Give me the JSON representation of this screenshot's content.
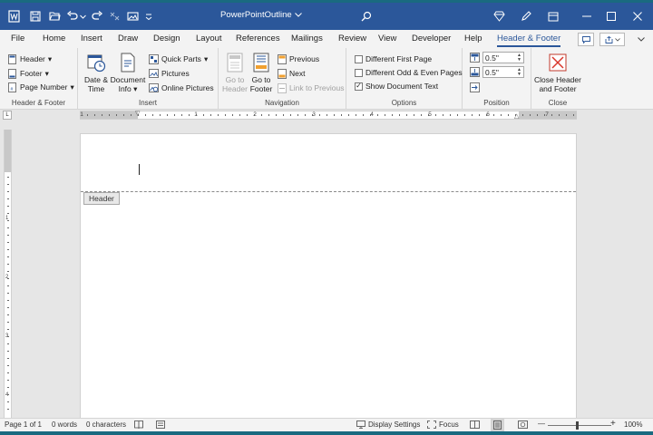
{
  "title_bar": {
    "doc_name": "PowerPointOutline",
    "quick_access": [
      "word-logo-icon",
      "save-icon",
      "open-icon",
      "undo-icon",
      "undo-dropdown-icon",
      "redo-icon",
      "format-painter-icon",
      "insert-picture-icon",
      "customize-icon"
    ]
  },
  "colors": {
    "brand": "#2b579a",
    "frame": "#1a6a80",
    "ribbon": "#f3f3f3",
    "canvas": "#e6e6e6"
  },
  "menu": {
    "tabs": [
      "File",
      "Home",
      "Insert",
      "Draw",
      "Design",
      "Layout",
      "References",
      "Mailings",
      "Review",
      "View",
      "Developer",
      "Help",
      "Header & Footer"
    ],
    "active_tab": "Header & Footer"
  },
  "ribbon": {
    "header_footer": {
      "label": "Header & Footer",
      "header": "Header",
      "footer": "Footer",
      "page_number": "Page Number"
    },
    "insert": {
      "label": "Insert",
      "date_time_1": "Date &",
      "date_time_2": "Time",
      "doc_info_1": "Document",
      "doc_info_2": "Info",
      "quick_parts": "Quick Parts",
      "pictures": "Pictures",
      "online_pictures": "Online Pictures"
    },
    "navigation": {
      "label": "Navigation",
      "go_header_1": "Go to",
      "go_header_2": "Header",
      "go_footer_1": "Go to",
      "go_footer_2": "Footer",
      "previous": "Previous",
      "next": "Next",
      "link_previous": "Link to Previous"
    },
    "options": {
      "label": "Options",
      "different_first": "Different First Page",
      "different_odd_even": "Different Odd & Even Pages",
      "show_doc_text": "Show Document Text",
      "different_first_checked": false,
      "different_odd_even_checked": false,
      "show_doc_text_checked": true
    },
    "position": {
      "label": "Position",
      "header_from_top": "0.5\"",
      "footer_from_bottom": "0.5\""
    },
    "close": {
      "label": "Close",
      "close_1": "Close Header",
      "close_2": "and Footer"
    }
  },
  "ruler": {
    "numbers": [
      "1",
      "1",
      "2",
      "3",
      "4",
      "5",
      "6",
      "7"
    ],
    "vnumbers": [
      "1",
      "2",
      "3",
      "4"
    ]
  },
  "document": {
    "header_tag": "Header"
  },
  "status": {
    "page": "Page 1 of 1",
    "words": "0 words",
    "characters": "0 characters",
    "display_settings": "Display Settings",
    "focus": "Focus",
    "zoom": "100%",
    "zoom_minus": "—",
    "zoom_plus": "+"
  }
}
